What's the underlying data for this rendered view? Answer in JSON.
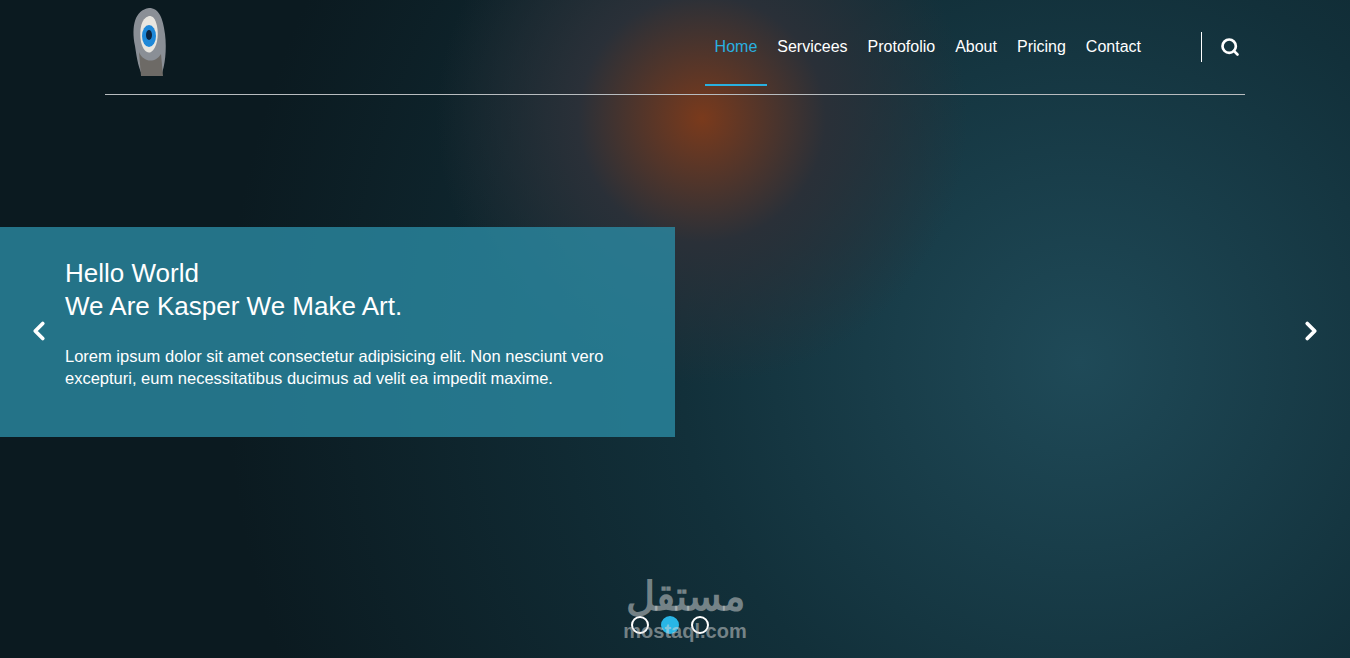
{
  "header": {
    "nav": [
      {
        "label": "Home",
        "selected": true
      },
      {
        "label": "Servicees",
        "selected": false
      },
      {
        "label": "Protofolio",
        "selected": false
      },
      {
        "label": "About",
        "selected": false
      },
      {
        "label": "Pricing",
        "selected": false
      },
      {
        "label": "Contact",
        "selected": false
      }
    ]
  },
  "hero": {
    "title_lines": [
      "Hello World",
      "We Are Kasper We Make Art."
    ],
    "text": "Lorem ipsum dolor sit amet consectetur adipisicing elit. Non nesciunt vero excepturi, eum necessitatibus ducimus ad velit ea impedit maxime."
  },
  "slider": {
    "dots": [
      {
        "selected": false
      },
      {
        "selected": true
      },
      {
        "selected": false
      }
    ]
  },
  "watermark": {
    "arabic": "مستقل",
    "latin": "mostaql.com"
  }
}
